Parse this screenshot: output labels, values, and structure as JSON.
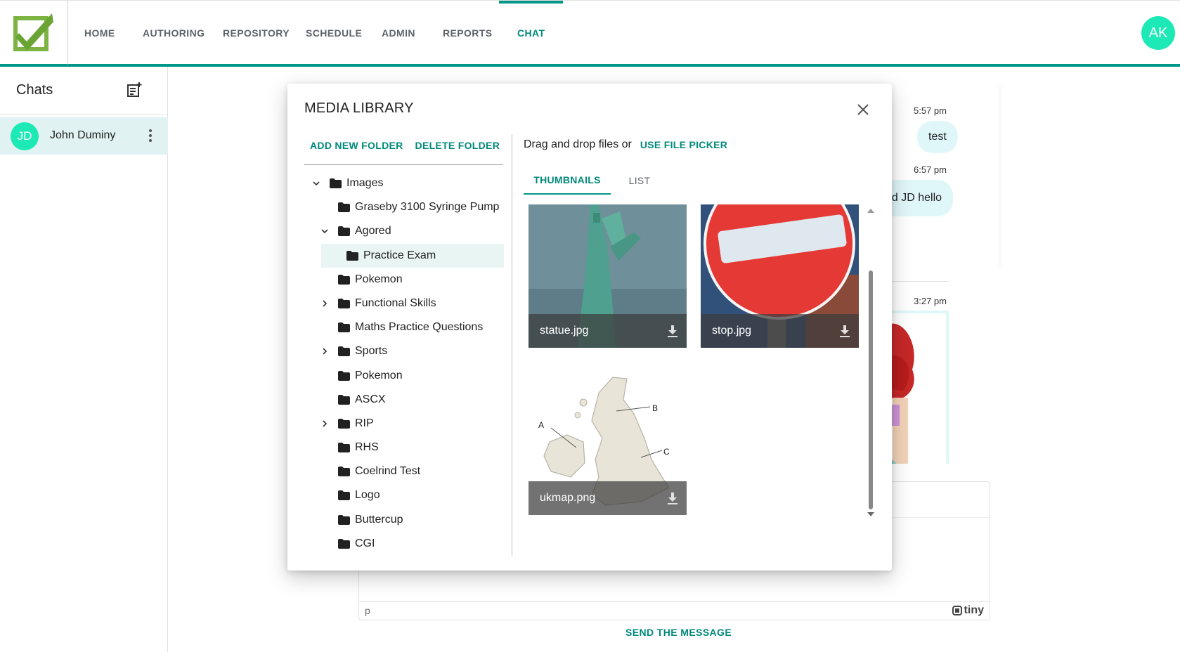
{
  "nav": {
    "items": [
      "HOME",
      "AUTHORING",
      "REPOSITORY",
      "SCHEDULE",
      "ADMIN",
      "REPORTS",
      "CHAT"
    ],
    "active": "CHAT",
    "user_initials": "AK",
    "accent_color": "#009688"
  },
  "chats": {
    "title": "Chats",
    "list": [
      {
        "initials": "JD",
        "name": "John Duminy"
      }
    ]
  },
  "conversation": {
    "messages": [
      {
        "time": "5:57 pm",
        "text": "test"
      },
      {
        "time": "6:57 pm",
        "text": "ed JD hello"
      },
      {
        "time": "3:27 pm",
        "text": ""
      }
    ],
    "editor_path": "p",
    "editor_brand": "tiny",
    "send_label": "SEND THE MESSAGE"
  },
  "media_library": {
    "title": "MEDIA LIBRARY",
    "add_folder_label": "ADD NEW FOLDER",
    "delete_folder_label": "DELETE FOLDER",
    "upload_text": "Drag and drop files or",
    "file_picker_label": "USE FILE PICKER",
    "tabs": {
      "thumbnails": "THUMBNAILS",
      "list": "LIST",
      "active": "THUMBNAILS"
    },
    "tree": [
      {
        "label": "Images",
        "level": 0,
        "expander": "expanded"
      },
      {
        "label": "Graseby 3100 Syringe Pump",
        "level": 1,
        "expander": "none"
      },
      {
        "label": "Agored",
        "level": 1,
        "expander": "expanded"
      },
      {
        "label": "Practice Exam",
        "level": 2,
        "expander": "none",
        "selected": true
      },
      {
        "label": "Pokemon",
        "level": 1,
        "expander": "none"
      },
      {
        "label": "Functional Skills",
        "level": 1,
        "expander": "collapsed"
      },
      {
        "label": "Maths Practice Questions",
        "level": 1,
        "expander": "none"
      },
      {
        "label": "Sports",
        "level": 1,
        "expander": "collapsed"
      },
      {
        "label": "Pokemon",
        "level": 1,
        "expander": "none"
      },
      {
        "label": "ASCX",
        "level": 1,
        "expander": "none"
      },
      {
        "label": "RIP",
        "level": 1,
        "expander": "collapsed"
      },
      {
        "label": "RHS",
        "level": 1,
        "expander": "none"
      },
      {
        "label": "Coelrind Test",
        "level": 1,
        "expander": "none"
      },
      {
        "label": "Logo",
        "level": 1,
        "expander": "none"
      },
      {
        "label": "Buttercup",
        "level": 1,
        "expander": "none"
      },
      {
        "label": "CGI",
        "level": 1,
        "expander": "none"
      }
    ],
    "files": [
      {
        "name": "statue.jpg"
      },
      {
        "name": "stop.jpg"
      },
      {
        "name": "ukmap.png",
        "map_labels": [
          "A",
          "B",
          "C"
        ]
      }
    ]
  }
}
